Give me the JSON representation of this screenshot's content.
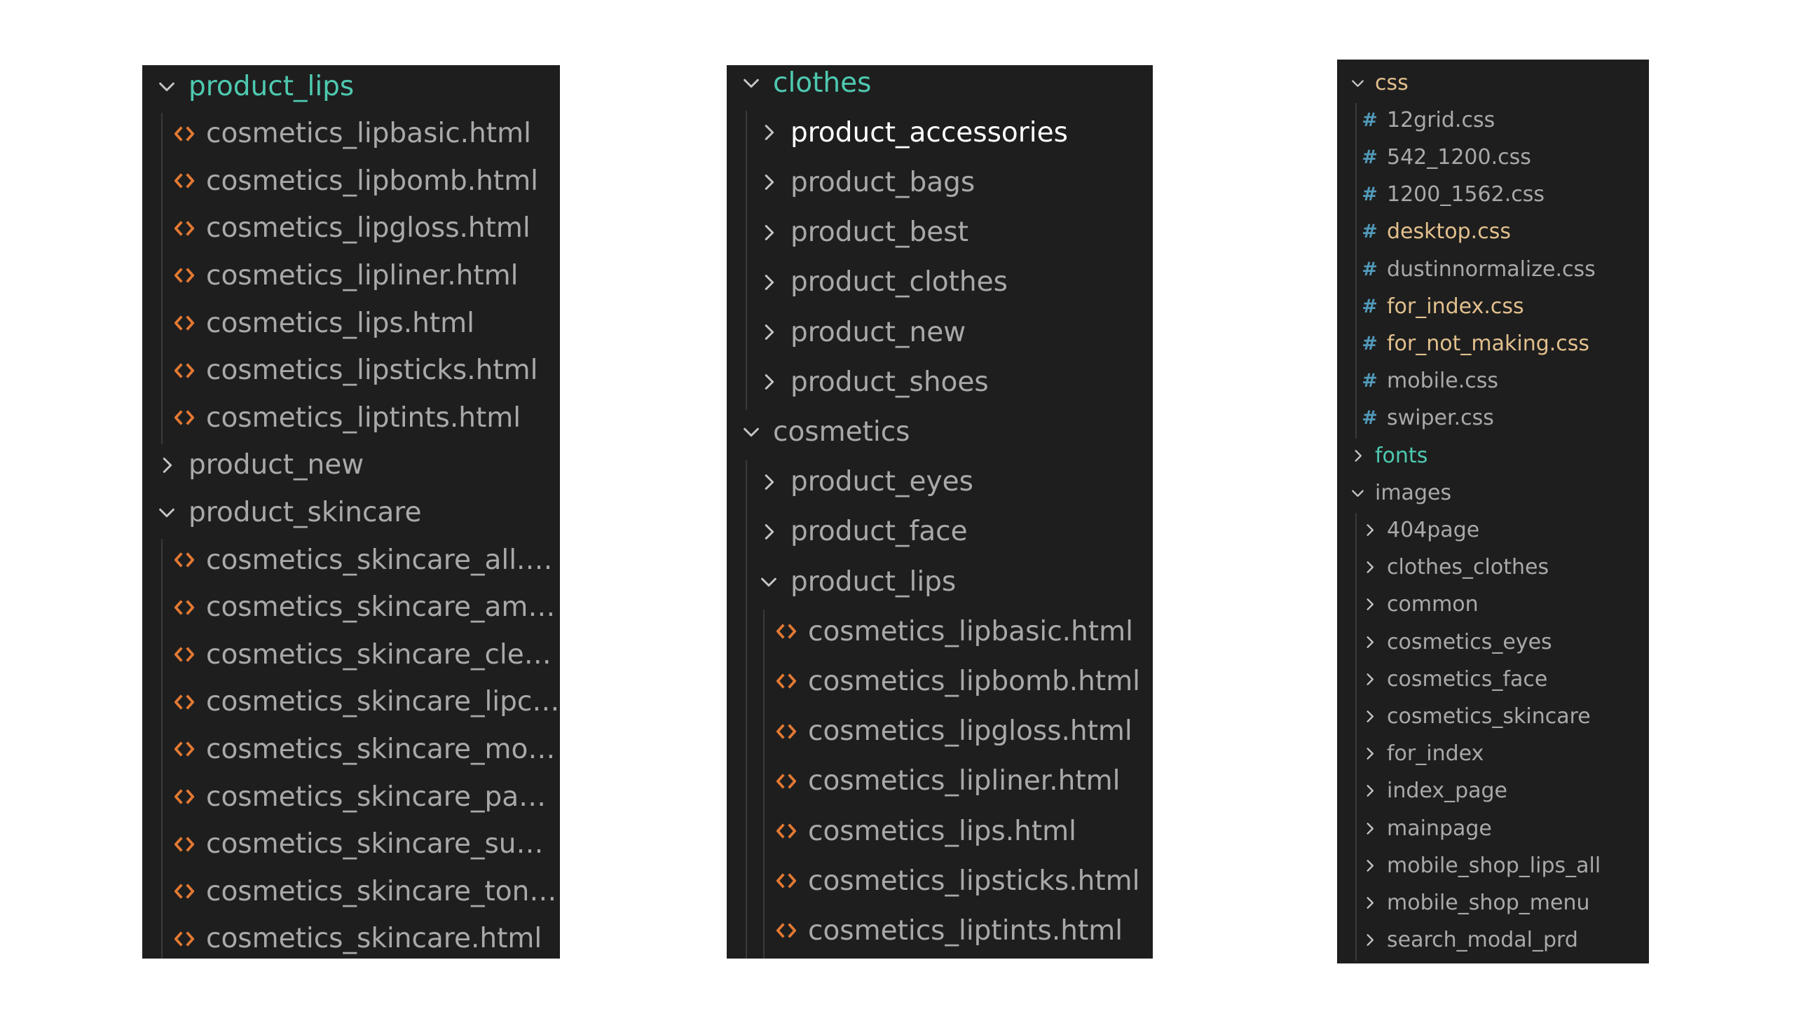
{
  "panel1": {
    "rows": [
      {
        "kind": "folder",
        "open": true,
        "depth": 0,
        "label": "product_lips",
        "color": "#4ec9b0"
      },
      {
        "kind": "html",
        "depth": 1,
        "label": "cosmetics_lipbasic.html"
      },
      {
        "kind": "html",
        "depth": 1,
        "label": "cosmetics_lipbomb.html"
      },
      {
        "kind": "html",
        "depth": 1,
        "label": "cosmetics_lipgloss.html"
      },
      {
        "kind": "html",
        "depth": 1,
        "label": "cosmetics_lipliner.html"
      },
      {
        "kind": "html",
        "depth": 1,
        "label": "cosmetics_lips.html"
      },
      {
        "kind": "html",
        "depth": 1,
        "label": "cosmetics_lipsticks.html"
      },
      {
        "kind": "html",
        "depth": 1,
        "label": "cosmetics_liptints.html"
      },
      {
        "kind": "folder",
        "open": false,
        "depth": 0,
        "label": "product_new"
      },
      {
        "kind": "folder",
        "open": true,
        "depth": 0,
        "label": "product_skincare"
      },
      {
        "kind": "html",
        "depth": 1,
        "label": "cosmetics_skincare_all.html"
      },
      {
        "kind": "html",
        "depth": 1,
        "label": "cosmetics_skincare_ample...."
      },
      {
        "kind": "html",
        "depth": 1,
        "label": "cosmetics_skincare_clense..."
      },
      {
        "kind": "html",
        "depth": 1,
        "label": "cosmetics_skincare_lipcare..."
      },
      {
        "kind": "html",
        "depth": 1,
        "label": "cosmetics_skincare_moistu..."
      },
      {
        "kind": "html",
        "depth": 1,
        "label": "cosmetics_skincare_pampe..."
      },
      {
        "kind": "html",
        "depth": 1,
        "label": "cosmetics_skincare_sunblo..."
      },
      {
        "kind": "html",
        "depth": 1,
        "label": "cosmetics_skincare_toners...."
      },
      {
        "kind": "html",
        "depth": 1,
        "label": "cosmetics_skincare.html"
      }
    ]
  },
  "panel2": {
    "rows": [
      {
        "kind": "folder",
        "open": true,
        "depth": 0,
        "label": "clothes",
        "color": "#4ec9b0"
      },
      {
        "kind": "folder",
        "open": false,
        "depth": 1,
        "label": "product_accessories",
        "color": "#ffffff"
      },
      {
        "kind": "folder",
        "open": false,
        "depth": 1,
        "label": "product_bags"
      },
      {
        "kind": "folder",
        "open": false,
        "depth": 1,
        "label": "product_best"
      },
      {
        "kind": "folder",
        "open": false,
        "depth": 1,
        "label": "product_clothes"
      },
      {
        "kind": "folder",
        "open": false,
        "depth": 1,
        "label": "product_new"
      },
      {
        "kind": "folder",
        "open": false,
        "depth": 1,
        "label": "product_shoes"
      },
      {
        "kind": "folder",
        "open": true,
        "depth": 0,
        "label": "cosmetics"
      },
      {
        "kind": "folder",
        "open": false,
        "depth": 1,
        "label": "product_eyes"
      },
      {
        "kind": "folder",
        "open": false,
        "depth": 1,
        "label": "product_face"
      },
      {
        "kind": "folder",
        "open": true,
        "depth": 1,
        "label": "product_lips"
      },
      {
        "kind": "html",
        "depth": 2,
        "label": "cosmetics_lipbasic.html"
      },
      {
        "kind": "html",
        "depth": 2,
        "label": "cosmetics_lipbomb.html"
      },
      {
        "kind": "html",
        "depth": 2,
        "label": "cosmetics_lipgloss.html"
      },
      {
        "kind": "html",
        "depth": 2,
        "label": "cosmetics_lipliner.html"
      },
      {
        "kind": "html",
        "depth": 2,
        "label": "cosmetics_lips.html"
      },
      {
        "kind": "html",
        "depth": 2,
        "label": "cosmetics_lipsticks.html"
      },
      {
        "kind": "html",
        "depth": 2,
        "label": "cosmetics_liptints.html"
      }
    ]
  },
  "panel3": {
    "rows": [
      {
        "kind": "folder",
        "open": true,
        "depth": 0,
        "label": "css",
        "color": "#e2c08d"
      },
      {
        "kind": "css",
        "depth": 1,
        "label": "12grid.css"
      },
      {
        "kind": "css",
        "depth": 1,
        "label": "542_1200.css"
      },
      {
        "kind": "css",
        "depth": 1,
        "label": "1200_1562.css"
      },
      {
        "kind": "css",
        "depth": 1,
        "label": "desktop.css",
        "color": "#e2c08d"
      },
      {
        "kind": "css",
        "depth": 1,
        "label": "dustinnormalize.css"
      },
      {
        "kind": "css",
        "depth": 1,
        "label": "for_index.css",
        "color": "#e2c08d"
      },
      {
        "kind": "css",
        "depth": 1,
        "label": "for_not_making.css",
        "color": "#e2c08d"
      },
      {
        "kind": "css",
        "depth": 1,
        "label": "mobile.css"
      },
      {
        "kind": "css",
        "depth": 1,
        "label": "swiper.css"
      },
      {
        "kind": "folder",
        "open": false,
        "depth": 0,
        "label": "fonts",
        "color": "#4ec9b0"
      },
      {
        "kind": "folder",
        "open": true,
        "depth": 0,
        "label": "images"
      },
      {
        "kind": "folder",
        "open": false,
        "depth": 1,
        "label": "404page"
      },
      {
        "kind": "folder",
        "open": false,
        "depth": 1,
        "label": "clothes_clothes"
      },
      {
        "kind": "folder",
        "open": false,
        "depth": 1,
        "label": "common"
      },
      {
        "kind": "folder",
        "open": false,
        "depth": 1,
        "label": "cosmetics_eyes"
      },
      {
        "kind": "folder",
        "open": false,
        "depth": 1,
        "label": "cosmetics_face"
      },
      {
        "kind": "folder",
        "open": false,
        "depth": 1,
        "label": "cosmetics_skincare"
      },
      {
        "kind": "folder",
        "open": false,
        "depth": 1,
        "label": "for_index"
      },
      {
        "kind": "folder",
        "open": false,
        "depth": 1,
        "label": "index_page"
      },
      {
        "kind": "folder",
        "open": false,
        "depth": 1,
        "label": "mainpage"
      },
      {
        "kind": "folder",
        "open": false,
        "depth": 1,
        "label": "mobile_shop_lips_all"
      },
      {
        "kind": "folder",
        "open": false,
        "depth": 1,
        "label": "mobile_shop_menu"
      },
      {
        "kind": "folder",
        "open": false,
        "depth": 1,
        "label": "search_modal_prd"
      }
    ]
  },
  "colors": {
    "panel_bg": "#1e1e1e",
    "text": "#a9a9a9",
    "html_icon": "#e37933",
    "css_icon": "#519aba",
    "chevron": "#c5c5c5"
  }
}
